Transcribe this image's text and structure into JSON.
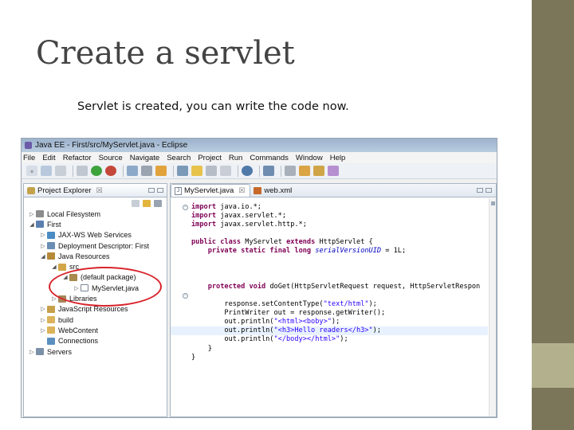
{
  "slide": {
    "title": "Create a servlet",
    "subtitle": "Servlet is created, you can write the code now."
  },
  "window": {
    "title": "Java EE - First/src/MyServlet.java - Eclipse"
  },
  "menu": [
    "File",
    "Edit",
    "Refactor",
    "Source",
    "Navigate",
    "Search",
    "Project",
    "Run",
    "Commands",
    "Window",
    "Help"
  ],
  "project_explorer": {
    "tab_label": "Project Explorer",
    "close_glyph": "☒",
    "items": [
      {
        "label": "Local Filesystem",
        "indent": 0,
        "icon": "filesystem-icon",
        "twisty": "▷"
      },
      {
        "label": "First",
        "indent": 0,
        "icon": "project-icon",
        "twisty": "◢"
      },
      {
        "label": "JAX-WS Web Services",
        "indent": 1,
        "icon": "webservice-icon",
        "twisty": "▷"
      },
      {
        "label": "Deployment Descriptor: First",
        "indent": 1,
        "icon": "descriptor-icon",
        "twisty": "▷"
      },
      {
        "label": "Java Resources",
        "indent": 1,
        "icon": "java-resources-icon",
        "twisty": "◢"
      },
      {
        "label": "src",
        "indent": 2,
        "icon": "source-folder-icon",
        "twisty": "◢"
      },
      {
        "label": "(default package)",
        "indent": 3,
        "icon": "package-icon",
        "twisty": "◢"
      },
      {
        "label": "MyServlet.java",
        "indent": 4,
        "icon": "java-file-icon",
        "twisty": "▷"
      },
      {
        "label": "Libraries",
        "indent": 2,
        "icon": "libraries-icon",
        "twisty": "▷"
      },
      {
        "label": "JavaScript Resources",
        "indent": 1,
        "icon": "javascript-icon",
        "twisty": "▷"
      },
      {
        "label": "build",
        "indent": 1,
        "icon": "folder-icon",
        "twisty": "▷"
      },
      {
        "label": "WebContent",
        "indent": 1,
        "icon": "folder-icon",
        "twisty": "▷"
      },
      {
        "label": "Connections",
        "indent": 1,
        "icon": "connections-icon",
        "twisty": ""
      },
      {
        "label": "Servers",
        "indent": 0,
        "icon": "servers-icon",
        "twisty": "▷"
      }
    ]
  },
  "editor": {
    "tabs": [
      {
        "label": "MyServlet.java",
        "active": true,
        "close_glyph": "☒"
      },
      {
        "label": "web.xml",
        "active": false
      }
    ],
    "code": [
      {
        "segments": [
          [
            "kw",
            "import"
          ],
          [
            "",
            "java.io.*;"
          ]
        ]
      },
      {
        "segments": [
          [
            "kw",
            "import"
          ],
          [
            "",
            "javax.servlet.*;"
          ]
        ]
      },
      {
        "segments": [
          [
            "kw",
            "import"
          ],
          [
            "",
            "javax.servlet.http.*;"
          ]
        ]
      },
      {
        "segments": [
          [
            "",
            ""
          ]
        ]
      },
      {
        "segments": [
          [
            "kw",
            "public"
          ],
          [
            "kw",
            "class"
          ],
          [
            "",
            "MyServlet"
          ],
          [
            "kw",
            "extends"
          ],
          [
            "",
            "HttpServlet {"
          ]
        ]
      },
      {
        "segments": [
          [
            "",
            "    "
          ],
          [
            "kw",
            "private"
          ],
          [
            "kw",
            "static"
          ],
          [
            "kw",
            "final"
          ],
          [
            "kw",
            "long"
          ],
          [
            "fld",
            "serialVersionUID"
          ],
          [
            "",
            "= 1L;"
          ]
        ]
      },
      {
        "segments": [
          [
            "",
            ""
          ]
        ]
      },
      {
        "segments": [
          [
            "",
            ""
          ]
        ]
      },
      {
        "segments": [
          [
            "",
            ""
          ]
        ]
      },
      {
        "segments": [
          [
            "",
            "    "
          ],
          [
            "kw",
            "protected"
          ],
          [
            "kw",
            "void"
          ],
          [
            "",
            "doGet(HttpServletRequest request, HttpServletRespon"
          ]
        ]
      },
      {
        "segments": [
          [
            "",
            ""
          ]
        ]
      },
      {
        "segments": [
          [
            "",
            "        response.setContentType("
          ],
          [
            "str",
            "\"text/html\""
          ],
          [
            "",
            ");"
          ]
        ]
      },
      {
        "segments": [
          [
            "",
            "        PrintWriter out = response.getWriter();"
          ]
        ]
      },
      {
        "segments": [
          [
            "",
            "        out.println("
          ],
          [
            "str",
            "\"<html><boby>\""
          ],
          [
            "",
            ");"
          ]
        ]
      },
      {
        "segments": [
          [
            "",
            "        out.println("
          ],
          [
            "str",
            "\"<h3>Hello readers</h3>\""
          ],
          [
            "",
            ");"
          ]
        ],
        "highlight": true
      },
      {
        "segments": [
          [
            "",
            "        out.println("
          ],
          [
            "str",
            "\"</body></html>\""
          ],
          [
            "",
            ");"
          ]
        ]
      },
      {
        "segments": [
          [
            "",
            "    }"
          ]
        ]
      },
      {
        "segments": [
          [
            "",
            "}"
          ]
        ]
      }
    ]
  },
  "colors": {
    "keyword": "#7f0055",
    "string": "#2a00ff",
    "field": "#0000c0",
    "annotation_circle": "#d8232a",
    "side_strip": "#7b7659",
    "side_accent": "#b3b08e"
  }
}
